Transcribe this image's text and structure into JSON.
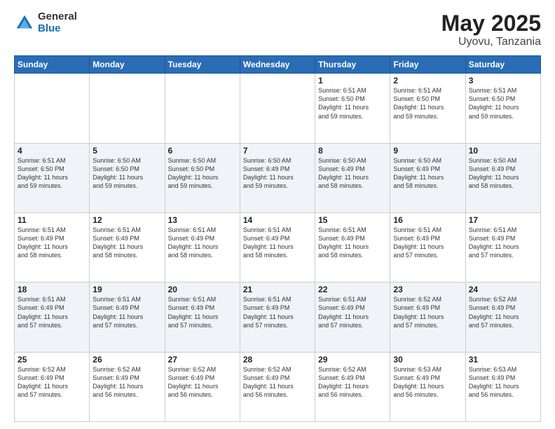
{
  "logo": {
    "general": "General",
    "blue": "Blue"
  },
  "title": {
    "month": "May 2025",
    "location": "Uyovu, Tanzania"
  },
  "days_header": [
    "Sunday",
    "Monday",
    "Tuesday",
    "Wednesday",
    "Thursday",
    "Friday",
    "Saturday"
  ],
  "weeks": [
    [
      {
        "num": "",
        "info": ""
      },
      {
        "num": "",
        "info": ""
      },
      {
        "num": "",
        "info": ""
      },
      {
        "num": "",
        "info": ""
      },
      {
        "num": "1",
        "info": "Sunrise: 6:51 AM\nSunset: 6:50 PM\nDaylight: 11 hours\nand 59 minutes."
      },
      {
        "num": "2",
        "info": "Sunrise: 6:51 AM\nSunset: 6:50 PM\nDaylight: 11 hours\nand 59 minutes."
      },
      {
        "num": "3",
        "info": "Sunrise: 6:51 AM\nSunset: 6:50 PM\nDaylight: 11 hours\nand 59 minutes."
      }
    ],
    [
      {
        "num": "4",
        "info": "Sunrise: 6:51 AM\nSunset: 6:50 PM\nDaylight: 11 hours\nand 59 minutes."
      },
      {
        "num": "5",
        "info": "Sunrise: 6:50 AM\nSunset: 6:50 PM\nDaylight: 11 hours\nand 59 minutes."
      },
      {
        "num": "6",
        "info": "Sunrise: 6:50 AM\nSunset: 6:50 PM\nDaylight: 11 hours\nand 59 minutes."
      },
      {
        "num": "7",
        "info": "Sunrise: 6:50 AM\nSunset: 6:49 PM\nDaylight: 11 hours\nand 59 minutes."
      },
      {
        "num": "8",
        "info": "Sunrise: 6:50 AM\nSunset: 6:49 PM\nDaylight: 11 hours\nand 58 minutes."
      },
      {
        "num": "9",
        "info": "Sunrise: 6:50 AM\nSunset: 6:49 PM\nDaylight: 11 hours\nand 58 minutes."
      },
      {
        "num": "10",
        "info": "Sunrise: 6:50 AM\nSunset: 6:49 PM\nDaylight: 11 hours\nand 58 minutes."
      }
    ],
    [
      {
        "num": "11",
        "info": "Sunrise: 6:51 AM\nSunset: 6:49 PM\nDaylight: 11 hours\nand 58 minutes."
      },
      {
        "num": "12",
        "info": "Sunrise: 6:51 AM\nSunset: 6:49 PM\nDaylight: 11 hours\nand 58 minutes."
      },
      {
        "num": "13",
        "info": "Sunrise: 6:51 AM\nSunset: 6:49 PM\nDaylight: 11 hours\nand 58 minutes."
      },
      {
        "num": "14",
        "info": "Sunrise: 6:51 AM\nSunset: 6:49 PM\nDaylight: 11 hours\nand 58 minutes."
      },
      {
        "num": "15",
        "info": "Sunrise: 6:51 AM\nSunset: 6:49 PM\nDaylight: 11 hours\nand 58 minutes."
      },
      {
        "num": "16",
        "info": "Sunrise: 6:51 AM\nSunset: 6:49 PM\nDaylight: 11 hours\nand 57 minutes."
      },
      {
        "num": "17",
        "info": "Sunrise: 6:51 AM\nSunset: 6:49 PM\nDaylight: 11 hours\nand 57 minutes."
      }
    ],
    [
      {
        "num": "18",
        "info": "Sunrise: 6:51 AM\nSunset: 6:49 PM\nDaylight: 11 hours\nand 57 minutes."
      },
      {
        "num": "19",
        "info": "Sunrise: 6:51 AM\nSunset: 6:49 PM\nDaylight: 11 hours\nand 57 minutes."
      },
      {
        "num": "20",
        "info": "Sunrise: 6:51 AM\nSunset: 6:49 PM\nDaylight: 11 hours\nand 57 minutes."
      },
      {
        "num": "21",
        "info": "Sunrise: 6:51 AM\nSunset: 6:49 PM\nDaylight: 11 hours\nand 57 minutes."
      },
      {
        "num": "22",
        "info": "Sunrise: 6:51 AM\nSunset: 6:49 PM\nDaylight: 11 hours\nand 57 minutes."
      },
      {
        "num": "23",
        "info": "Sunrise: 6:52 AM\nSunset: 6:49 PM\nDaylight: 11 hours\nand 57 minutes."
      },
      {
        "num": "24",
        "info": "Sunrise: 6:52 AM\nSunset: 6:49 PM\nDaylight: 11 hours\nand 57 minutes."
      }
    ],
    [
      {
        "num": "25",
        "info": "Sunrise: 6:52 AM\nSunset: 6:49 PM\nDaylight: 11 hours\nand 57 minutes."
      },
      {
        "num": "26",
        "info": "Sunrise: 6:52 AM\nSunset: 6:49 PM\nDaylight: 11 hours\nand 56 minutes."
      },
      {
        "num": "27",
        "info": "Sunrise: 6:52 AM\nSunset: 6:49 PM\nDaylight: 11 hours\nand 56 minutes."
      },
      {
        "num": "28",
        "info": "Sunrise: 6:52 AM\nSunset: 6:49 PM\nDaylight: 11 hours\nand 56 minutes."
      },
      {
        "num": "29",
        "info": "Sunrise: 6:52 AM\nSunset: 6:49 PM\nDaylight: 11 hours\nand 56 minutes."
      },
      {
        "num": "30",
        "info": "Sunrise: 6:53 AM\nSunset: 6:49 PM\nDaylight: 11 hours\nand 56 minutes."
      },
      {
        "num": "31",
        "info": "Sunrise: 6:53 AM\nSunset: 6:49 PM\nDaylight: 11 hours\nand 56 minutes."
      }
    ]
  ]
}
